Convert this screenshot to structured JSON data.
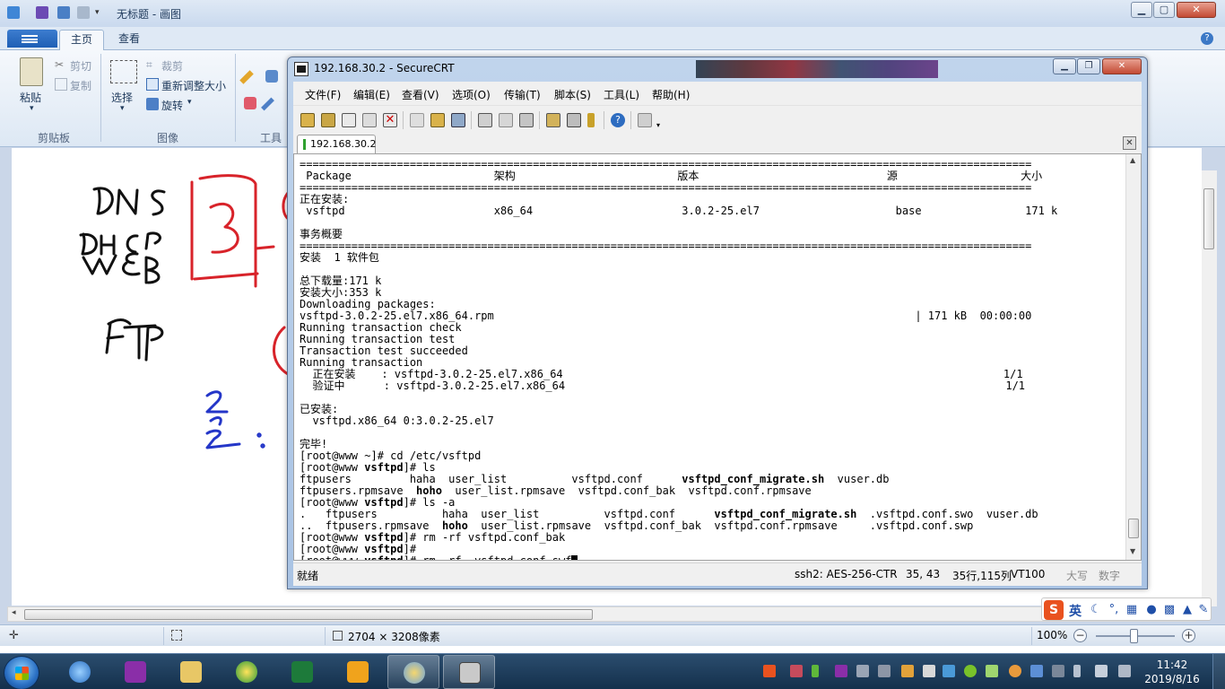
{
  "paint": {
    "title": "无标题 - 画图",
    "tabs": {
      "home": "主页",
      "view": "查看"
    },
    "ribbon": {
      "paste": "粘贴",
      "cut": "剪切",
      "copy": "复制",
      "clipboard_group": "剪贴板",
      "select": "选择",
      "crop": "裁剪",
      "resize": "重新调整大小",
      "rotate": "旋转",
      "image_group": "图像",
      "tools_group": "工具"
    },
    "status": {
      "dimensions": "2704 × 3208像素",
      "zoom": "100%"
    }
  },
  "crt": {
    "title": "192.168.30.2 - SecureCRT",
    "menu": [
      "文件(F)",
      "编辑(E)",
      "查看(V)",
      "选项(O)",
      "传输(T)",
      "脚本(S)",
      "工具(L)",
      "帮助(H)"
    ],
    "session_tab": "192.168.30.2",
    "status": {
      "ready": "就绪",
      "cipher": "ssh2: AES-256-CTR",
      "cursor": "35,  43",
      "rows_cols": "35行,115列",
      "term": "VT100",
      "caps": "大写",
      "num": "数字"
    },
    "terminal_lines": [
      "=================================================================================================================",
      " Package                      架构                         版本                             源                   大小",
      "=================================================================================================================",
      "正在安装:",
      " vsftpd                       x86_64                       3.0.2-25.el7                     base                171 k",
      "",
      "事务概要",
      "=================================================================================================================",
      "安装  1 软件包",
      "",
      "总下载量:171 k",
      "安装大小:353 k",
      "Downloading packages:",
      "vsftpd-3.0.2-25.el7.x86_64.rpm                                                                 | 171 kB  00:00:00",
      "Running transaction check",
      "Running transaction test",
      "Transaction test succeeded",
      "Running transaction",
      "  正在安装    : vsftpd-3.0.2-25.el7.x86_64                                                                    1/1",
      "  验证中      : vsftpd-3.0.2-25.el7.x86_64                                                                    1/1",
      "",
      "已安装:",
      "  vsftpd.x86_64 0:3.0.2-25.el7",
      "",
      "完毕!",
      "[root@www ~]# cd /etc/vsftpd",
      "[root@www vsftpd]# ls",
      "ftpusers         haha  user_list          vsftpd.conf      vsftpd_conf_migrate.sh  vuser.db",
      "ftpusers.rpmsave  hoho  user_list.rpmsave  vsftpd.conf_bak  vsftpd.conf.rpmsave",
      "[root@www vsftpd]# ls -a",
      ".   ftpusers          haha  user_list          vsftpd.conf      vsftpd_conf_migrate.sh  .vsftpd.conf.swo  vuser.db",
      "..  ftpusers.rpmsave  hoho  user_list.rpmsave  vsftpd.conf_bak  vsftpd.conf.rpmsave     .vsftpd.conf.swp",
      "[root@www vsftpd]# rm -rf vsftpd.conf_bak",
      "[root@www vsftpd]#",
      "[root@www vsftpd]# rm -rf .vsftpd.conf.swf"
    ]
  },
  "ime": {
    "logo": "S",
    "lang": "英"
  },
  "taskbar": {
    "clock_time": "11:42",
    "clock_date": "2019/8/16"
  },
  "colors": {
    "accent": "#1f5fb5",
    "paint_drawing_red": "#d8232a",
    "paint_drawing_blue": "#2436c8"
  }
}
